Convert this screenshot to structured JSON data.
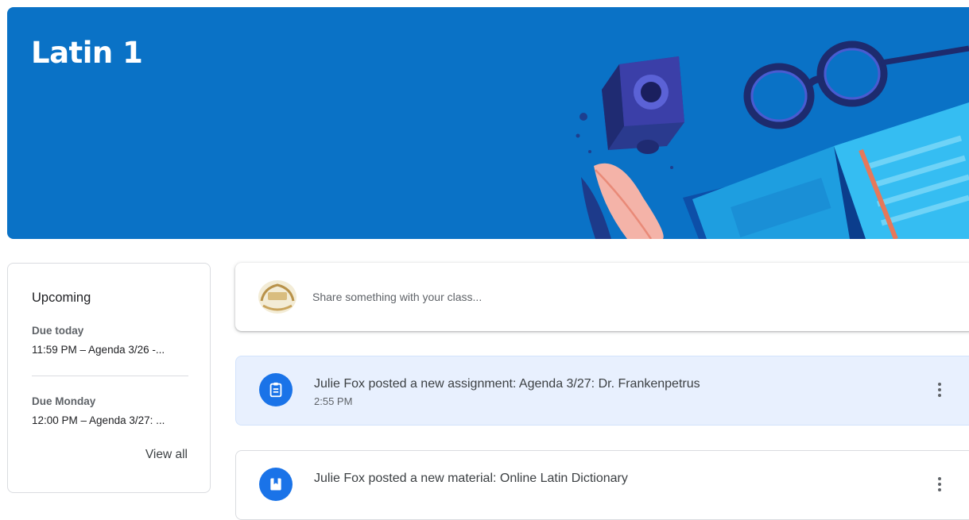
{
  "course": {
    "title": "Latin 1"
  },
  "upcoming": {
    "title": "Upcoming",
    "groups": [
      {
        "label": "Due today",
        "item": "11:59 PM – Agenda 3/26 -..."
      },
      {
        "label": "Due Monday",
        "item": "12:00 PM – Agenda 3/27: ..."
      }
    ],
    "view_all": "View all"
  },
  "share": {
    "placeholder": "Share something with your class..."
  },
  "stream": [
    {
      "title": "Julie Fox posted a new assignment: Agenda 3/27: Dr. Frankenpetrus",
      "time": "2:55 PM",
      "icon": "assignment-icon"
    },
    {
      "title": "Julie Fox posted a new material: Online Latin Dictionary",
      "time": "",
      "icon": "material-icon"
    }
  ],
  "colors": {
    "banner": "#0a72c6",
    "accent": "#1a73e8",
    "highlight": "#e8f0fe"
  }
}
